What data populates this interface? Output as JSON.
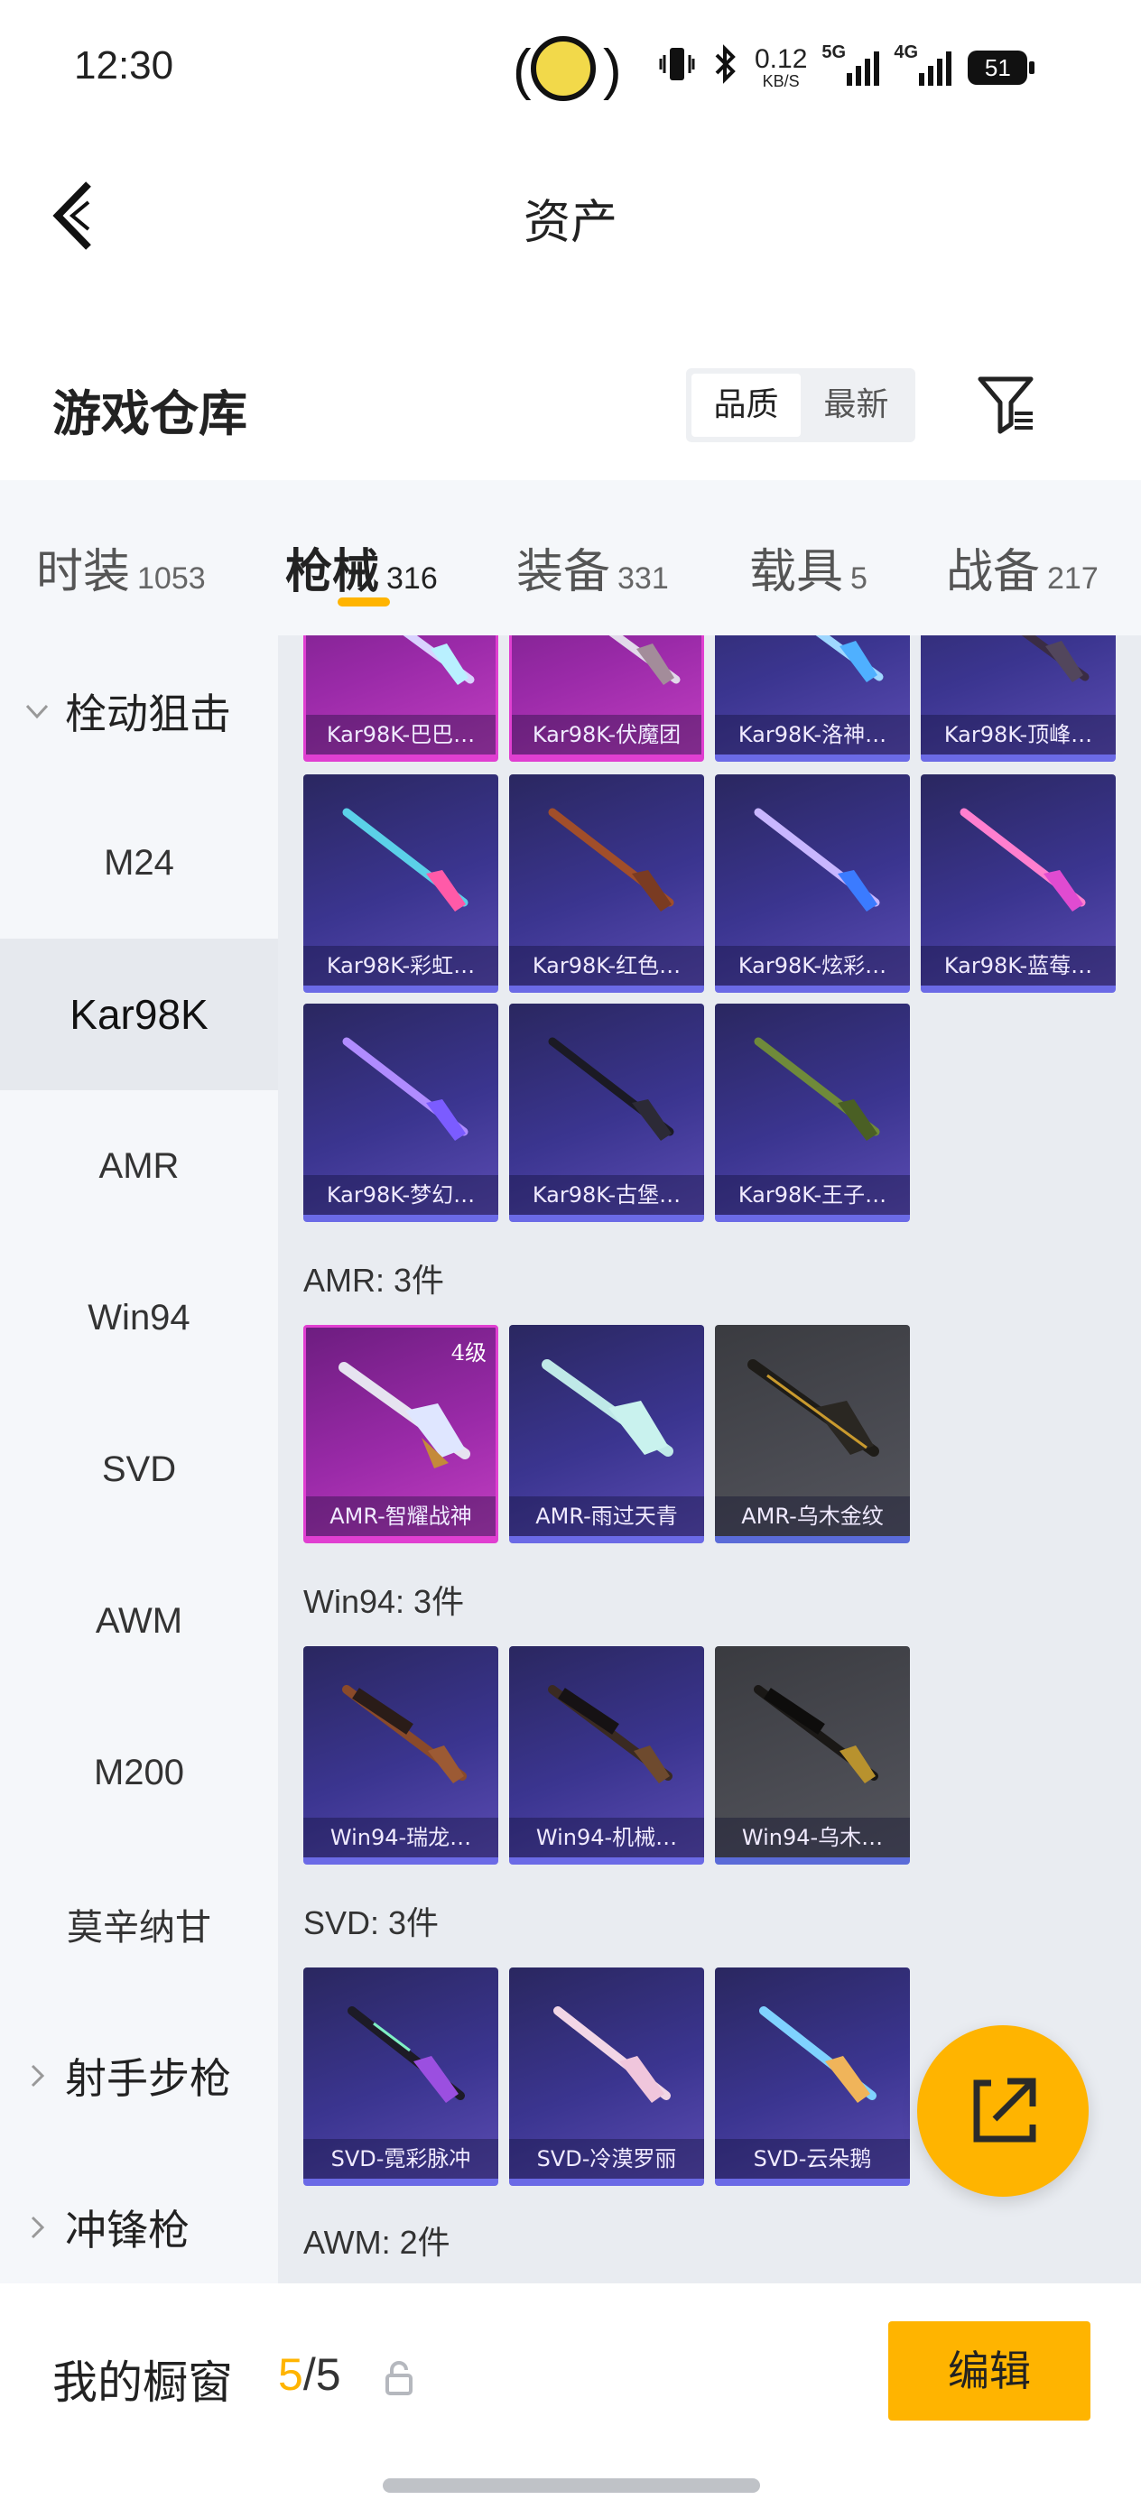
{
  "status_bar": {
    "time": "12:30",
    "speed_value": "0.12",
    "speed_unit": "KB/S",
    "net1": "5G",
    "net2": "4G",
    "battery": "51"
  },
  "nav": {
    "title": "资产"
  },
  "warehouse": {
    "title": "游戏仓库",
    "sort": {
      "options": [
        "品质",
        "最新"
      ],
      "selected": "品质"
    }
  },
  "tabs": [
    {
      "label": "时装",
      "count": "1053",
      "active": false
    },
    {
      "label": "枪械",
      "count": "316",
      "active": true
    },
    {
      "label": "装备",
      "count": "331",
      "active": false
    },
    {
      "label": "载具",
      "count": "5",
      "active": false
    },
    {
      "label": "战备",
      "count": "217",
      "active": false
    }
  ],
  "sidebar": {
    "category_open": "栓动狙击",
    "items": [
      "M24",
      "Kar98K",
      "AMR",
      "Win94",
      "SVD",
      "AWM",
      "M200",
      "莫辛纳甘"
    ],
    "active_item": "Kar98K",
    "category_closed_1": "射手步枪",
    "category_closed_2": "冲锋枪"
  },
  "content": {
    "kar98k_row1": [
      "Kar98K-巴巴…",
      "Kar98K-伏魔团",
      "Kar98K-洛神…",
      "Kar98K-顶峰…"
    ],
    "kar98k_row2": [
      "Kar98K-彩虹…",
      "Kar98K-红色…",
      "Kar98K-炫彩…",
      "Kar98K-蓝莓…"
    ],
    "kar98k_row3": [
      "Kar98K-梦幻…",
      "Kar98K-古堡…",
      "Kar98K-王子…"
    ],
    "amr": {
      "title": "AMR: 3件",
      "items": [
        "AMR-智耀战神",
        "AMR-雨过天青",
        "AMR-乌木金纹"
      ],
      "badge": "4级"
    },
    "win94": {
      "title": "Win94: 3件",
      "items": [
        "Win94-瑞龙…",
        "Win94-机械…",
        "Win94-乌木…"
      ]
    },
    "svd": {
      "title": "SVD: 3件",
      "items": [
        "SVD-霓彩脉冲",
        "SVD-冷漠罗丽",
        "SVD-云朵鹅"
      ]
    },
    "awm": {
      "title": "AWM: 2件"
    }
  },
  "bottom": {
    "label": "我的橱窗",
    "count_current": "5",
    "count_total": "/5",
    "edit_label": "编辑"
  },
  "colors": {
    "accent": "#ffb400",
    "card_blue": "#3b3590",
    "card_pink": "#9a2aa8",
    "card_grey": "#4a4b52"
  }
}
